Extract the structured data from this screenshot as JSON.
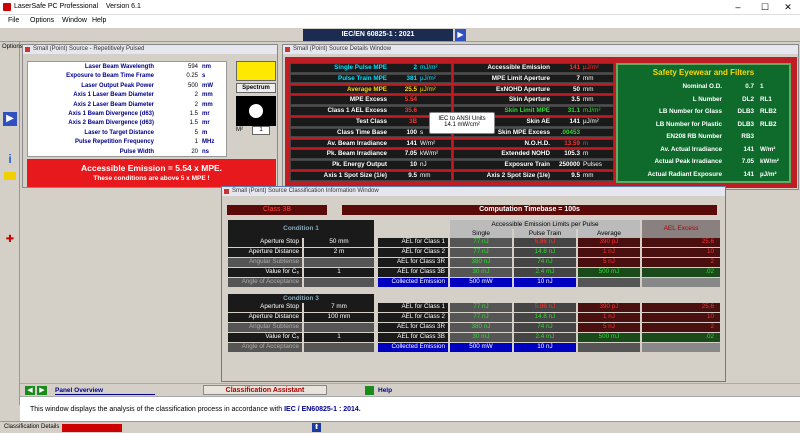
{
  "app": {
    "title": "LaserSafe PC Professional",
    "version": "Version 6.1",
    "menu": [
      "File",
      "Options",
      "Window",
      "Help"
    ],
    "standard": "IEC/EN 60825-1 : 2021",
    "options_label": "Options"
  },
  "params": {
    "title": "Small (Point) Source - Repetitively Pulsed",
    "rows": [
      {
        "label": "Laser Beam Wavelength",
        "value": "594",
        "unit": "nm"
      },
      {
        "label": "Exposure to Beam Time Frame",
        "value": "0.25",
        "unit": "s"
      },
      {
        "label": "Laser Output Peak Power",
        "value": "500",
        "unit": "mW"
      },
      {
        "label": "Axis 1 Laser Beam Diameter",
        "value": "2",
        "unit": "mm"
      },
      {
        "label": "Axis 2 Laser Beam Diameter",
        "value": "2",
        "unit": "mm"
      },
      {
        "label": "Axis 1 Beam Divergence (d63)",
        "value": "1.5",
        "unit": "mr"
      },
      {
        "label": "Axis 2 Beam Divergence (d63)",
        "value": "1.5",
        "unit": "mr"
      },
      {
        "label": "Laser to Target Distance",
        "value": "5",
        "unit": "m"
      },
      {
        "label": "Pulse Repetition Frequency",
        "value": "1",
        "unit": "MHz"
      },
      {
        "label": "Pulse Width",
        "value": "20",
        "unit": "ns"
      }
    ],
    "alert1": "Accessible Emission = 5.54 x MPE.",
    "alert2": "These conditions are above 5 x MPE !",
    "spectrum": "Spectrum",
    "m2_label": "M²",
    "m2_value": "1"
  },
  "details": {
    "title": "Small (Point) Source Details Window",
    "col1": [
      {
        "label": "Single Pulse MPE",
        "value": "2",
        "unit": "mJ/m²",
        "lc": "cy",
        "vc": "cy"
      },
      {
        "label": "Pulse Train MPE",
        "value": "381",
        "unit": "µJ/m²",
        "lc": "cy",
        "vc": "cy"
      },
      {
        "label": "Average MPE",
        "value": "25.5",
        "unit": "µJ/m²",
        "lc": "yel",
        "vc": "yel"
      },
      {
        "label": "MPE Excess",
        "value": "5.54",
        "unit": "",
        "lc": "",
        "vc": "red"
      },
      {
        "label": "Class 1 AEL Excess",
        "value": "35.6",
        "unit": "",
        "lc": "",
        "vc": "red"
      },
      {
        "label": "Test Class",
        "value": "3B",
        "unit": "",
        "lc": "",
        "vc": "red"
      },
      {
        "label": "Class Time Base",
        "value": "100",
        "unit": "s",
        "lc": "",
        "vc": ""
      },
      {
        "label": "Av. Beam Irradiance",
        "value": "141",
        "unit": "W/m²",
        "lc": "",
        "vc": ""
      },
      {
        "label": "Pk. Beam Irradiance",
        "value": "7.05",
        "unit": "kW/m²",
        "lc": "",
        "vc": ""
      },
      {
        "label": "Pk. Energy Output",
        "value": "10",
        "unit": "nJ",
        "lc": "",
        "vc": ""
      },
      {
        "label": "Axis 1 Spot Size (1/e)",
        "value": "9.5",
        "unit": "mm",
        "lc": "",
        "vc": ""
      }
    ],
    "col2": [
      {
        "label": "Accessible Emission",
        "value": "141",
        "unit": "µJ/m²",
        "lc": "",
        "vc": "red"
      },
      {
        "label": "MPE Limit Aperture",
        "value": "7",
        "unit": "mm",
        "lc": "",
        "vc": ""
      },
      {
        "label": "ExNOHD Aperture",
        "value": "50",
        "unit": "mm",
        "lc": "",
        "vc": ""
      },
      {
        "label": "Skin Aperture",
        "value": "3.5",
        "unit": "mm",
        "lc": "",
        "vc": ""
      },
      {
        "label": "Skin Limit MPE",
        "value": "31.1",
        "unit": "mJ/m²",
        "lc": "grn",
        "vc": "grn"
      },
      {
        "label": "Skin AE",
        "value": "141",
        "unit": "µJ/m²",
        "lc": "",
        "vc": ""
      },
      {
        "label": "Skin MPE Excess",
        "value": ".00453",
        "unit": "",
        "lc": "",
        "vc": "grn"
      },
      {
        "label": "N.O.H.D.",
        "value": "13.59",
        "unit": "m",
        "lc": "",
        "vc": "red"
      },
      {
        "label": "Extended NOHD",
        "value": "105.3",
        "unit": "m",
        "lc": "",
        "vc": ""
      },
      {
        "label": "Exposure Train",
        "value": "250000",
        "unit": "Pulses",
        "lc": "",
        "vc": ""
      },
      {
        "label": "Axis 2 Spot Size (1/e)",
        "value": "9.5",
        "unit": "mm",
        "lc": "",
        "vc": ""
      }
    ],
    "tooltip1": "IEC to ANSI Units",
    "tooltip2": "14.1 mW/cm²",
    "eyewear": {
      "title": "Safety Eyewear and Filters",
      "rows": [
        {
          "label": "Nominal O.D.",
          "v1": "0.7",
          "v2": "1"
        },
        {
          "label": "L Number",
          "v1": "DL2",
          "v2": "RL1"
        },
        {
          "label": "LB Number for Glass",
          "v1": "DLB3",
          "v2": "RLB2"
        },
        {
          "label": "LB Number for Plastic",
          "v1": "DLB3",
          "v2": "RLB2"
        },
        {
          "label": "EN208 RB Number",
          "v1": "RB3",
          "v2": ""
        },
        {
          "label": "Av. Actual Irradiance",
          "v1": "141",
          "v2": "W/m²"
        },
        {
          "label": "Actual Peak Irradiance",
          "v1": "7.05",
          "v2": "kW/m²"
        },
        {
          "label": "Actual Radiant Exposure",
          "v1": "141",
          "v2": "µJ/m²"
        }
      ]
    }
  },
  "classwin": {
    "title": "Small (Point) Source Classification Information Window",
    "class": "Class 3B",
    "timebase": "Computation Timebase = 100s",
    "ael_header": "Accessible Emission Limits per Pulse",
    "cols": [
      "Single",
      "Pulse Train",
      "Average"
    ],
    "excess": "AEL Excess",
    "conditions": [
      {
        "name": "Condition 1",
        "left": [
          [
            "Aperture Stop",
            "50 mm"
          ],
          [
            "Aperture Distance",
            "2 m"
          ],
          [
            "Angular Subtense",
            ""
          ],
          [
            "Value for C₆",
            "1"
          ],
          [
            "Angle of Acceptance",
            ""
          ]
        ],
        "rows": [
          [
            "AEL for Class 1",
            "77 nJ",
            "5.86 nJ",
            "390 pJ",
            "25.6"
          ],
          [
            "AEL for Class 2",
            "77 nJ",
            "14.8 nJ",
            "1 nJ",
            "10"
          ],
          [
            "AEL for Class 3R",
            "380 nJ",
            "74 nJ",
            "5 nJ",
            "2"
          ],
          [
            "AEL for Class 3B",
            "30 mJ",
            "2.4 mJ",
            "500 mJ",
            ".02"
          ],
          [
            "Collected Emission",
            "500 mW",
            "10 nJ",
            "",
            ""
          ]
        ]
      },
      {
        "name": "Condition 3",
        "left": [
          [
            "Aperture Stop",
            "7 mm"
          ],
          [
            "Aperture Distance",
            "100 mm"
          ],
          [
            "Angular Subtense",
            ""
          ],
          [
            "Value for C₆",
            "1"
          ],
          [
            "Angle of Acceptance",
            ""
          ]
        ],
        "rows": [
          [
            "AEL for Class 1",
            "77 nJ",
            "5.86 nJ",
            "390 pJ",
            "25.6"
          ],
          [
            "AEL for Class 2",
            "77 nJ",
            "14.8 nJ",
            "1 nJ",
            "10"
          ],
          [
            "AEL for Class 3R",
            "380 nJ",
            "74 nJ",
            "5 nJ",
            "2"
          ],
          [
            "AEL for Class 3B",
            "30 mJ",
            "2.4 mJ",
            "500 mJ",
            ".02"
          ],
          [
            "Collected Emission",
            "500 mW",
            "10 nJ",
            "",
            ""
          ]
        ]
      }
    ]
  },
  "bottom": {
    "panel_overview": "Panel Overview",
    "assistant": "Classification Assistant",
    "help": "Help",
    "info_pre": "This window displays the analysis of the classification process in accordance with ",
    "info_std": "IEC / EN60825-1 : 2014."
  },
  "status": {
    "left": "Classification Details"
  }
}
